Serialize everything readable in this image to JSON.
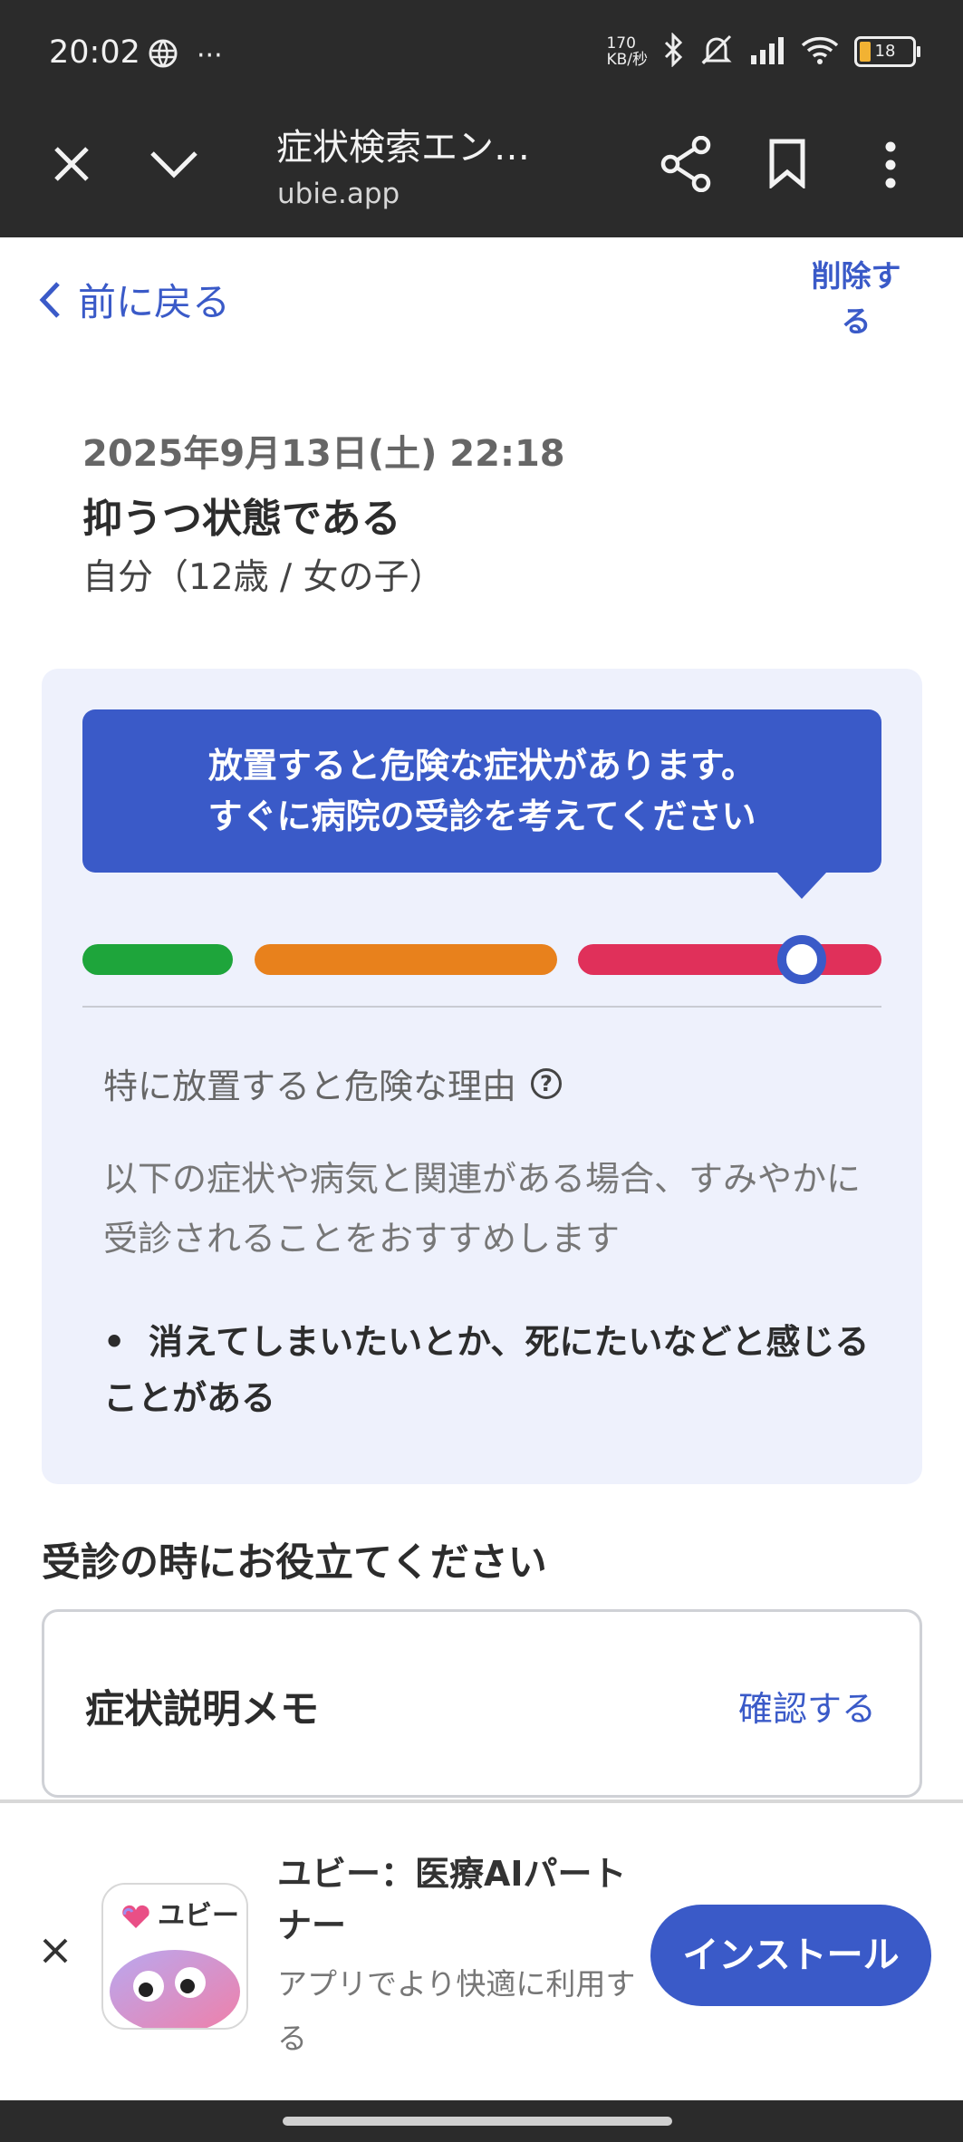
{
  "status_bar": {
    "time": "20:02",
    "more": "···",
    "net_speed_value": "170",
    "net_speed_unit": "KB/秒",
    "battery_level": "18",
    "icons": [
      "vpn-globe-icon",
      "bluetooth-icon",
      "silent-mode-icon",
      "signal-icon",
      "wifi-icon",
      "battery-icon"
    ]
  },
  "browser": {
    "title": "症状検索エン…",
    "url": "ubie.app",
    "icons": [
      "close-icon",
      "chevron-down-icon",
      "share-icon",
      "bookmark-icon",
      "more-vert-icon"
    ]
  },
  "page": {
    "back_label": "前に戻る",
    "delete_label": "削除する",
    "datetime": "2025年9月13日(土) 22:18",
    "title": "抑うつ状態である",
    "patient": "自分（12歳 / 女の子）"
  },
  "urgency": {
    "alert_line1": "放置すると危険な症状があります。",
    "alert_line2": "すぐに病院の受診を考えてください",
    "level": "high",
    "marker_position_fraction": 0.9,
    "level_colors": [
      "#1ea53b",
      "#e8811c",
      "#e0305a"
    ],
    "reason_heading": "特に放置すると危険な理由",
    "reason_help": "?",
    "reason_description": "以下の症状や病気と関連がある場合、すみやかに受診されることをおすすめします",
    "reasons": [
      {
        "bullet": "•",
        "text": "消えてしまいたいとか、死にたいなどと感じることがある"
      }
    ]
  },
  "help_section": {
    "heading": "受診の時にお役立てください",
    "memo_label": "症状説明メモ",
    "memo_action": "確認する"
  },
  "install_banner": {
    "app_icon_text": "ユビー",
    "app_name": "ユビー：医療AIパートナー",
    "app_subtitle": "アプリでより快適に利用する",
    "install_label": "インストール"
  },
  "colors": {
    "accent": "#3a5ac8",
    "card_background": "#eef1fc",
    "chrome": "#2b2b2b"
  }
}
